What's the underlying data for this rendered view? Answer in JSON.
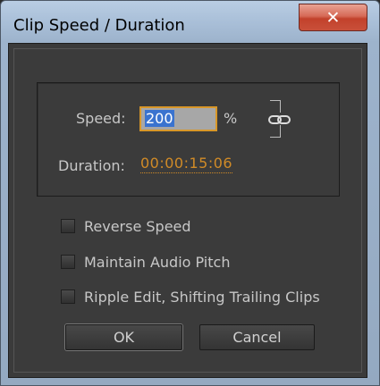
{
  "window": {
    "title": "Clip Speed / Duration",
    "close_icon": "close-icon",
    "close_glyph": "✕"
  },
  "speed": {
    "label": "Speed:",
    "value": "200",
    "unit": "%",
    "link_icon": "chain-link-icon"
  },
  "duration": {
    "label": "Duration:",
    "value": "00:00:15:06"
  },
  "options": [
    {
      "label": "Reverse Speed",
      "checked": false
    },
    {
      "label": "Maintain Audio Pitch",
      "checked": false
    },
    {
      "label": "Ripple Edit, Shifting Trailing Clips",
      "checked": false
    }
  ],
  "buttons": {
    "ok": "OK",
    "cancel": "Cancel"
  },
  "colors": {
    "accent_orange": "#d18b27",
    "selection_blue": "#3a73cf",
    "panel_bg": "#3b3b3b",
    "titlebar": "#a9bfd8",
    "close_red": "#c2412b"
  }
}
